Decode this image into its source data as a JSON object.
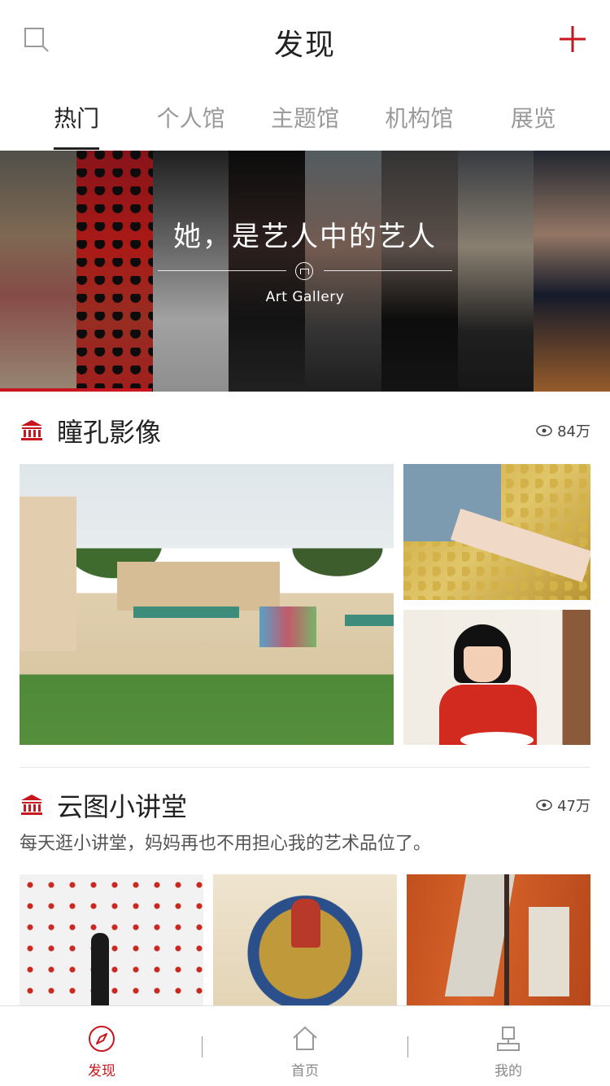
{
  "header": {
    "title": "发现",
    "search_icon": "search-icon",
    "add_icon": "plus-icon",
    "accent": "#c8161e"
  },
  "tabs": [
    {
      "label": "热门",
      "active": true
    },
    {
      "label": "个人馆",
      "active": false
    },
    {
      "label": "主题馆",
      "active": false
    },
    {
      "label": "机构馆",
      "active": false
    },
    {
      "label": "展览",
      "active": false
    }
  ],
  "banner": {
    "headline": "她，是艺人中的艺人",
    "subtitle": "Art Gallery"
  },
  "sections": [
    {
      "name": "瞳孔影像",
      "views": "84万"
    },
    {
      "name": "云图小讲堂",
      "views": "47万",
      "description": "每天逛小讲堂，妈妈再也不用担心我的艺术品位了。"
    }
  ],
  "bottom_nav": [
    {
      "label": "发现",
      "icon": "compass-icon",
      "active": true
    },
    {
      "label": "首页",
      "icon": "home-icon",
      "active": false
    },
    {
      "label": "我的",
      "icon": "user-icon",
      "active": false
    }
  ]
}
